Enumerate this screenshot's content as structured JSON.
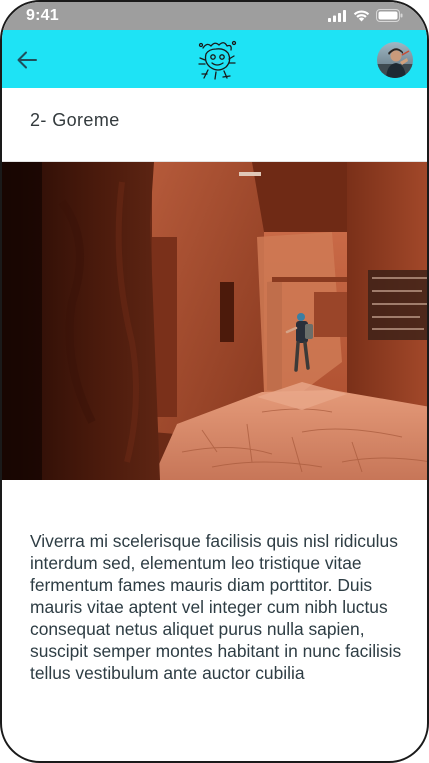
{
  "status_bar": {
    "time": "9:41"
  },
  "app_bar": {
    "back_icon": "arrow-left-icon",
    "logo_icon": "doodle-logo-icon",
    "avatar": "user-avatar"
  },
  "colors": {
    "app_bar": "#1ee3f5",
    "status_bar": "#9e9e9e",
    "text": "#2e3d44"
  },
  "article": {
    "title": "2- Goreme",
    "body": "Viverra mi scelerisque facilisis quis nisl ridiculus interdum sed, elementum leo tristique vitae fermentum fames mauris diam porttitor. Duis mauris vitae aptent vel integer cum nibh luctus consequat netus aliquet purus nulla sapien, suscipit semper montes habitant in nunc facilisis tellus vestibulum ante auctor cubilia"
  }
}
